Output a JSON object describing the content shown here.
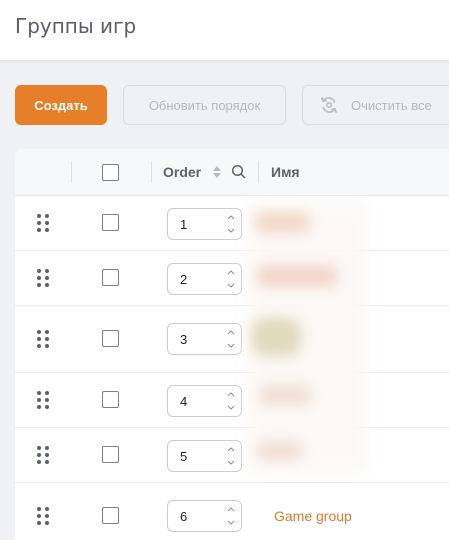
{
  "header": {
    "title": "Группы игр"
  },
  "toolbar": {
    "create_label": "Создать",
    "refresh_order_label": "Обновить порядок",
    "clear_all_label": "Очистить все"
  },
  "table": {
    "columns": {
      "order": "Order",
      "name": "Имя"
    },
    "rows": [
      {
        "order": "1",
        "name": ""
      },
      {
        "order": "2",
        "name": ""
      },
      {
        "order": "3",
        "name": ""
      },
      {
        "order": "4",
        "name": ""
      },
      {
        "order": "5",
        "name": ""
      },
      {
        "order": "6",
        "name": "Game group"
      }
    ]
  },
  "colors": {
    "accent": "#e67e2a",
    "link": "#d97a32"
  }
}
